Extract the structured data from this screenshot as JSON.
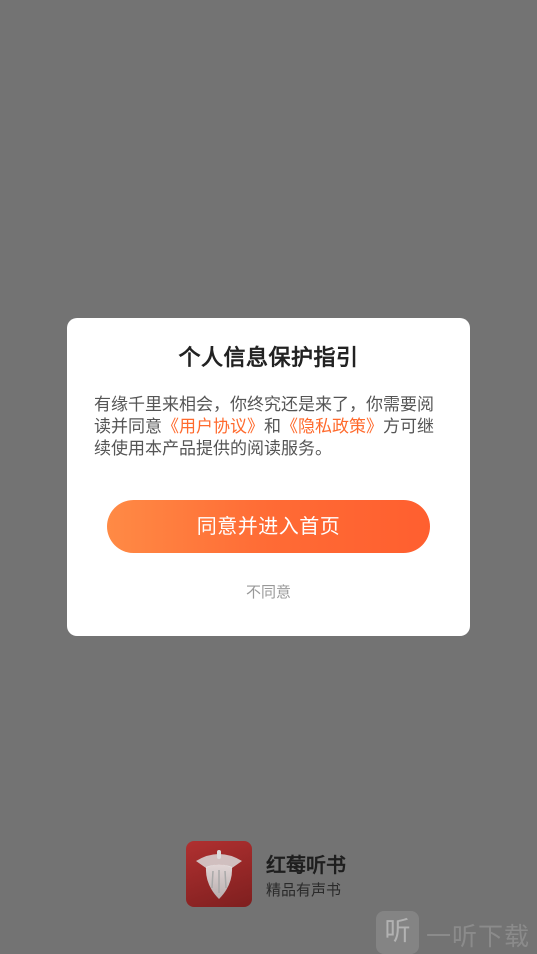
{
  "dialog": {
    "title": "个人信息保护指引",
    "body_part1": "有缘千里来相会，你终究还是来了，你需要阅读并同意",
    "user_agreement_link": "《用户协议》",
    "conjunction": "和",
    "privacy_policy_link": "《隐私政策》",
    "body_part2": "方可继续使用本产品提供的阅读服务。",
    "agree_button": "同意并进入首页",
    "disagree_button": "不同意"
  },
  "brand": {
    "name": "红莓听书",
    "slogan": "精品有声书",
    "logo_icon": "raspberry-logo-icon"
  },
  "watermark": {
    "icon_glyph": "听",
    "text": "一听下载"
  },
  "colors": {
    "overlay": "#737373",
    "accent": "#ff6a2d",
    "button_gradient_start": "#ff8a45",
    "button_gradient_end": "#ff5f2f",
    "logo_red": "#a32a2a"
  }
}
